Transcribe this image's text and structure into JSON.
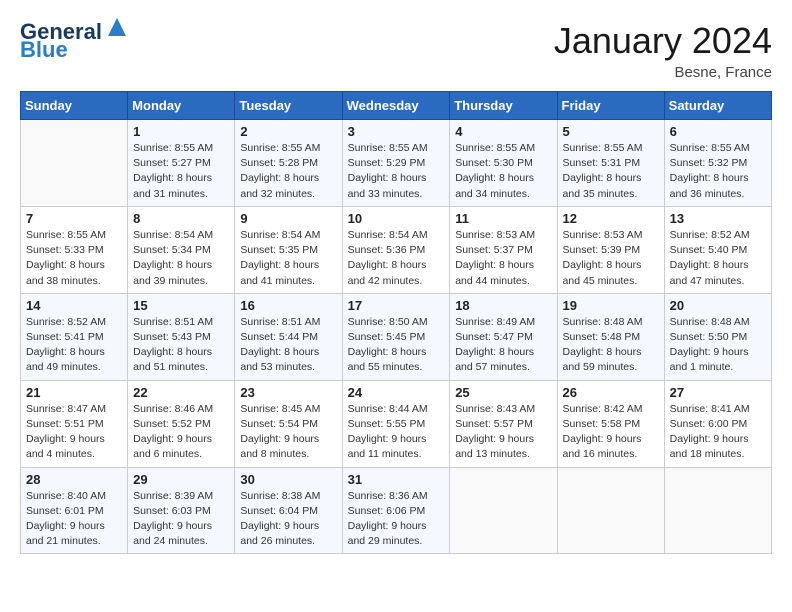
{
  "header": {
    "logo_line1": "General",
    "logo_line2": "Blue",
    "month_title": "January 2024",
    "location": "Besne, France"
  },
  "weekdays": [
    "Sunday",
    "Monday",
    "Tuesday",
    "Wednesday",
    "Thursday",
    "Friday",
    "Saturday"
  ],
  "weeks": [
    [
      {
        "day": "",
        "info": ""
      },
      {
        "day": "1",
        "info": "Sunrise: 8:55 AM\nSunset: 5:27 PM\nDaylight: 8 hours\nand 31 minutes."
      },
      {
        "day": "2",
        "info": "Sunrise: 8:55 AM\nSunset: 5:28 PM\nDaylight: 8 hours\nand 32 minutes."
      },
      {
        "day": "3",
        "info": "Sunrise: 8:55 AM\nSunset: 5:29 PM\nDaylight: 8 hours\nand 33 minutes."
      },
      {
        "day": "4",
        "info": "Sunrise: 8:55 AM\nSunset: 5:30 PM\nDaylight: 8 hours\nand 34 minutes."
      },
      {
        "day": "5",
        "info": "Sunrise: 8:55 AM\nSunset: 5:31 PM\nDaylight: 8 hours\nand 35 minutes."
      },
      {
        "day": "6",
        "info": "Sunrise: 8:55 AM\nSunset: 5:32 PM\nDaylight: 8 hours\nand 36 minutes."
      }
    ],
    [
      {
        "day": "7",
        "info": "Sunrise: 8:55 AM\nSunset: 5:33 PM\nDaylight: 8 hours\nand 38 minutes."
      },
      {
        "day": "8",
        "info": "Sunrise: 8:54 AM\nSunset: 5:34 PM\nDaylight: 8 hours\nand 39 minutes."
      },
      {
        "day": "9",
        "info": "Sunrise: 8:54 AM\nSunset: 5:35 PM\nDaylight: 8 hours\nand 41 minutes."
      },
      {
        "day": "10",
        "info": "Sunrise: 8:54 AM\nSunset: 5:36 PM\nDaylight: 8 hours\nand 42 minutes."
      },
      {
        "day": "11",
        "info": "Sunrise: 8:53 AM\nSunset: 5:37 PM\nDaylight: 8 hours\nand 44 minutes."
      },
      {
        "day": "12",
        "info": "Sunrise: 8:53 AM\nSunset: 5:39 PM\nDaylight: 8 hours\nand 45 minutes."
      },
      {
        "day": "13",
        "info": "Sunrise: 8:52 AM\nSunset: 5:40 PM\nDaylight: 8 hours\nand 47 minutes."
      }
    ],
    [
      {
        "day": "14",
        "info": "Sunrise: 8:52 AM\nSunset: 5:41 PM\nDaylight: 8 hours\nand 49 minutes."
      },
      {
        "day": "15",
        "info": "Sunrise: 8:51 AM\nSunset: 5:43 PM\nDaylight: 8 hours\nand 51 minutes."
      },
      {
        "day": "16",
        "info": "Sunrise: 8:51 AM\nSunset: 5:44 PM\nDaylight: 8 hours\nand 53 minutes."
      },
      {
        "day": "17",
        "info": "Sunrise: 8:50 AM\nSunset: 5:45 PM\nDaylight: 8 hours\nand 55 minutes."
      },
      {
        "day": "18",
        "info": "Sunrise: 8:49 AM\nSunset: 5:47 PM\nDaylight: 8 hours\nand 57 minutes."
      },
      {
        "day": "19",
        "info": "Sunrise: 8:48 AM\nSunset: 5:48 PM\nDaylight: 8 hours\nand 59 minutes."
      },
      {
        "day": "20",
        "info": "Sunrise: 8:48 AM\nSunset: 5:50 PM\nDaylight: 9 hours\nand 1 minute."
      }
    ],
    [
      {
        "day": "21",
        "info": "Sunrise: 8:47 AM\nSunset: 5:51 PM\nDaylight: 9 hours\nand 4 minutes."
      },
      {
        "day": "22",
        "info": "Sunrise: 8:46 AM\nSunset: 5:52 PM\nDaylight: 9 hours\nand 6 minutes."
      },
      {
        "day": "23",
        "info": "Sunrise: 8:45 AM\nSunset: 5:54 PM\nDaylight: 9 hours\nand 8 minutes."
      },
      {
        "day": "24",
        "info": "Sunrise: 8:44 AM\nSunset: 5:55 PM\nDaylight: 9 hours\nand 11 minutes."
      },
      {
        "day": "25",
        "info": "Sunrise: 8:43 AM\nSunset: 5:57 PM\nDaylight: 9 hours\nand 13 minutes."
      },
      {
        "day": "26",
        "info": "Sunrise: 8:42 AM\nSunset: 5:58 PM\nDaylight: 9 hours\nand 16 minutes."
      },
      {
        "day": "27",
        "info": "Sunrise: 8:41 AM\nSunset: 6:00 PM\nDaylight: 9 hours\nand 18 minutes."
      }
    ],
    [
      {
        "day": "28",
        "info": "Sunrise: 8:40 AM\nSunset: 6:01 PM\nDaylight: 9 hours\nand 21 minutes."
      },
      {
        "day": "29",
        "info": "Sunrise: 8:39 AM\nSunset: 6:03 PM\nDaylight: 9 hours\nand 24 minutes."
      },
      {
        "day": "30",
        "info": "Sunrise: 8:38 AM\nSunset: 6:04 PM\nDaylight: 9 hours\nand 26 minutes."
      },
      {
        "day": "31",
        "info": "Sunrise: 8:36 AM\nSunset: 6:06 PM\nDaylight: 9 hours\nand 29 minutes."
      },
      {
        "day": "",
        "info": ""
      },
      {
        "day": "",
        "info": ""
      },
      {
        "day": "",
        "info": ""
      }
    ]
  ]
}
